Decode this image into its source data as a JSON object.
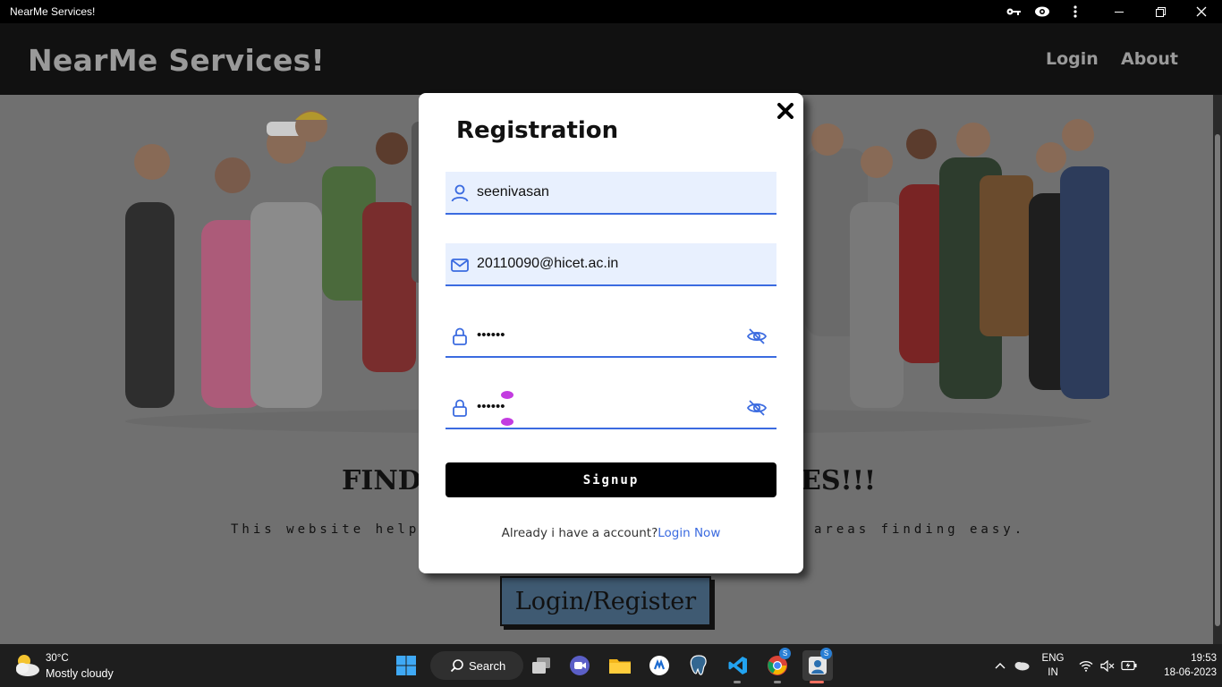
{
  "window": {
    "title": "NearMe Services!"
  },
  "navbar": {
    "brand": "NearMe Services!",
    "links": [
      "Login",
      "About"
    ]
  },
  "hero": {
    "heading_left": "FIND",
    "heading_right": "ES!!!",
    "text_left": "This website help to",
    "text_right": "areas finding easy.",
    "button_label": "Login/Register"
  },
  "modal": {
    "title": "Registration",
    "username_value": "seenivasan",
    "email_value": "20110090@hicet.ac.in",
    "password_value": "••••••",
    "confirm_password_value": "••••••",
    "signup_label": "Signup",
    "footer_text": "Already i have a account?",
    "footer_link": "Login Now"
  },
  "taskbar": {
    "weather_temp": "30°C",
    "weather_desc": "Mostly cloudy",
    "search_label": "Search",
    "lang_top": "ENG",
    "lang_bottom": "IN",
    "time": "19:53",
    "date": "18-06-2023",
    "badge": "S"
  },
  "colors": {
    "accent": "#3b6be0",
    "field_fill": "#e8f0fe",
    "button": "#000000"
  }
}
